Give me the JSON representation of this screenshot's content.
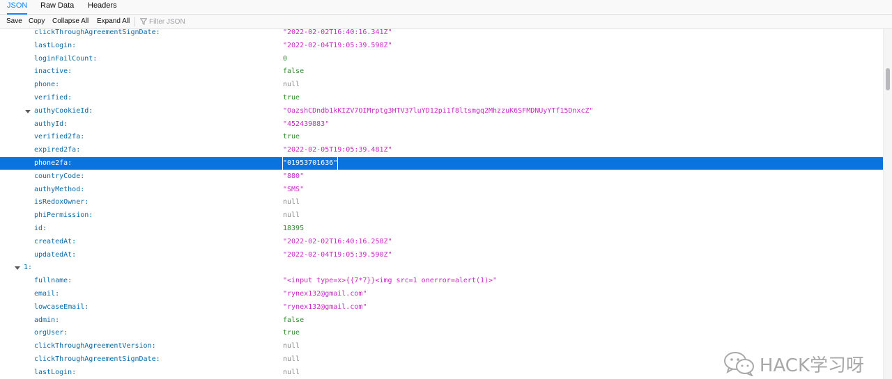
{
  "tabs": [
    {
      "label": "JSON",
      "selected": true
    },
    {
      "label": "Raw Data",
      "selected": false
    },
    {
      "label": "Headers",
      "selected": false
    }
  ],
  "toolbar": {
    "save_label": "Save",
    "copy_label": "Copy",
    "collapse_label": "Collapse All",
    "expand_label": "Expand All",
    "filter_placeholder": "Filter JSON",
    "filter_icon": "filter-icon"
  },
  "rows": [
    {
      "key": "clickThroughAgreementSignDate:",
      "value": "\"2022-02-02T16:40:16.341Z\"",
      "type": "string",
      "indent": 1
    },
    {
      "key": "lastLogin:",
      "value": "\"2022-02-04T19:05:39.590Z\"",
      "type": "string",
      "indent": 1
    },
    {
      "key": "loginFailCount:",
      "value": "0",
      "type": "number",
      "indent": 1
    },
    {
      "key": "inactive:",
      "value": "false",
      "type": "bool",
      "indent": 1
    },
    {
      "key": "phone:",
      "value": "null",
      "type": "null",
      "indent": 1
    },
    {
      "key": "verified:",
      "value": "true",
      "type": "bool",
      "indent": 1
    },
    {
      "key": "authyCookieId:",
      "value": "\"OazshCDndb1kKIZV7OIMrptg3HTV37luYD12pi1f8ltsmgq2MhzzuK6SFMDNUyYTf15DnxcZ\"",
      "type": "string",
      "indent": 1,
      "twisty": true
    },
    {
      "key": "authyId:",
      "value": "\"452439883\"",
      "type": "string",
      "indent": 1
    },
    {
      "key": "verified2fa:",
      "value": "true",
      "type": "bool",
      "indent": 1
    },
    {
      "key": "expired2fa:",
      "value": "\"2022-02-05T19:05:39.481Z\"",
      "type": "string",
      "indent": 1
    },
    {
      "key": "phone2fa:",
      "value": "\"01953701636\"",
      "type": "string",
      "indent": 1,
      "selected": true
    },
    {
      "key": "countryCode:",
      "value": "\"880\"",
      "type": "string",
      "indent": 1
    },
    {
      "key": "authyMethod:",
      "value": "\"SMS\"",
      "type": "string",
      "indent": 1
    },
    {
      "key": "isRedoxOwner:",
      "value": "null",
      "type": "null",
      "indent": 1
    },
    {
      "key": "phiPermission:",
      "value": "null",
      "type": "null",
      "indent": 1
    },
    {
      "key": "id:",
      "value": "18395",
      "type": "number",
      "indent": 1
    },
    {
      "key": "createdAt:",
      "value": "\"2022-02-02T16:40:16.258Z\"",
      "type": "string",
      "indent": 1
    },
    {
      "key": "updatedAt:",
      "value": "\"2022-02-04T19:05:39.590Z\"",
      "type": "string",
      "indent": 1
    },
    {
      "key": "1:",
      "value": "",
      "type": "object",
      "indent": 0,
      "twisty": true
    },
    {
      "key": "fullname:",
      "value": "\"<input type=x>{{7*7}}<img src=1 onerror=alert(1)>\"",
      "type": "string",
      "indent": 1
    },
    {
      "key": "email:",
      "value": "\"rynex132@gmail.com\"",
      "type": "string",
      "indent": 1
    },
    {
      "key": "lowcaseEmail:",
      "value": "\"rynex132@gmail.com\"",
      "type": "string",
      "indent": 1
    },
    {
      "key": "admin:",
      "value": "false",
      "type": "bool",
      "indent": 1
    },
    {
      "key": "orgUser:",
      "value": "true",
      "type": "bool",
      "indent": 1
    },
    {
      "key": "clickThroughAgreementVersion:",
      "value": "null",
      "type": "null",
      "indent": 1
    },
    {
      "key": "clickThroughAgreementSignDate:",
      "value": "null",
      "type": "null",
      "indent": 1
    },
    {
      "key": "lastLogin:",
      "value": "null",
      "type": "null",
      "indent": 1
    }
  ],
  "watermark": {
    "text": "HACK学习呀",
    "icon": "wechat-icon"
  },
  "colors": {
    "accent": "#0a84ff",
    "selection": "#0a73e0",
    "key": "#0a6aa8",
    "string": "#c928c4",
    "number": "#2f8a2f",
    "null": "#8a8a8a"
  }
}
